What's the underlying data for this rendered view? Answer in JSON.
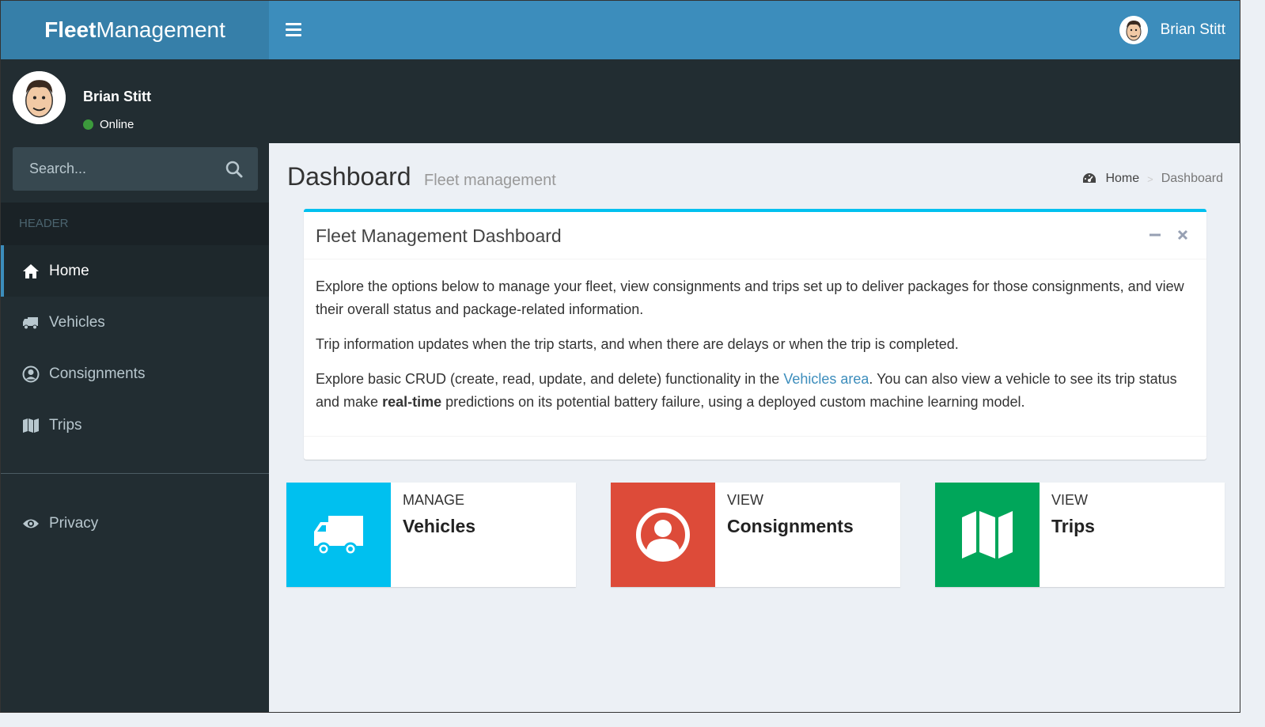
{
  "brand": {
    "bold": "Fleet",
    "rest": "Management"
  },
  "topbar": {
    "user_name": "Brian Stitt",
    "menu_icon": "bars-icon"
  },
  "user_panel": {
    "name": "Brian Stitt",
    "status": "Online",
    "status_color": "#3c9a3c"
  },
  "search": {
    "placeholder": "Search..."
  },
  "sidebar": {
    "header": "HEADER",
    "items": [
      {
        "label": "Home",
        "icon": "home-icon",
        "active": true
      },
      {
        "label": "Vehicles",
        "icon": "truck-icon",
        "active": false
      },
      {
        "label": "Consignments",
        "icon": "user-circle-icon",
        "active": false
      },
      {
        "label": "Trips",
        "icon": "map-icon",
        "active": false
      }
    ],
    "secondary": [
      {
        "label": "Privacy",
        "icon": "eye-icon"
      }
    ]
  },
  "content": {
    "title": "Dashboard",
    "subtitle": "Fleet management",
    "breadcrumb": {
      "home": "Home",
      "separator": ">",
      "current": "Dashboard"
    }
  },
  "box": {
    "title": "Fleet Management Dashboard",
    "p1": "Explore the options below to manage your fleet, view consignments and trips set up to deliver packages for those consignments, and view their overall status and package-related information.",
    "p2": "Trip information updates when the trip starts, and when there are delays or when the trip is completed.",
    "p3_a": "Explore basic CRUD (create, read, update, and delete) functionality in the ",
    "p3_link": "Vehicles area",
    "p3_b": ". You can also view a vehicle to see its trip status and make ",
    "p3_bold": "real-time",
    "p3_c": " predictions on its potential battery failure, using a deployed custom machine learning model."
  },
  "info_boxes": [
    {
      "small": "MANAGE",
      "big": "Vehicles",
      "icon": "truck-icon",
      "color": "#00c0ef"
    },
    {
      "small": "VIEW",
      "big": "Consignments",
      "icon": "user-circle-icon",
      "color": "#dd4b39"
    },
    {
      "small": "VIEW",
      "big": "Trips",
      "icon": "map-icon",
      "color": "#00a65a"
    }
  ]
}
